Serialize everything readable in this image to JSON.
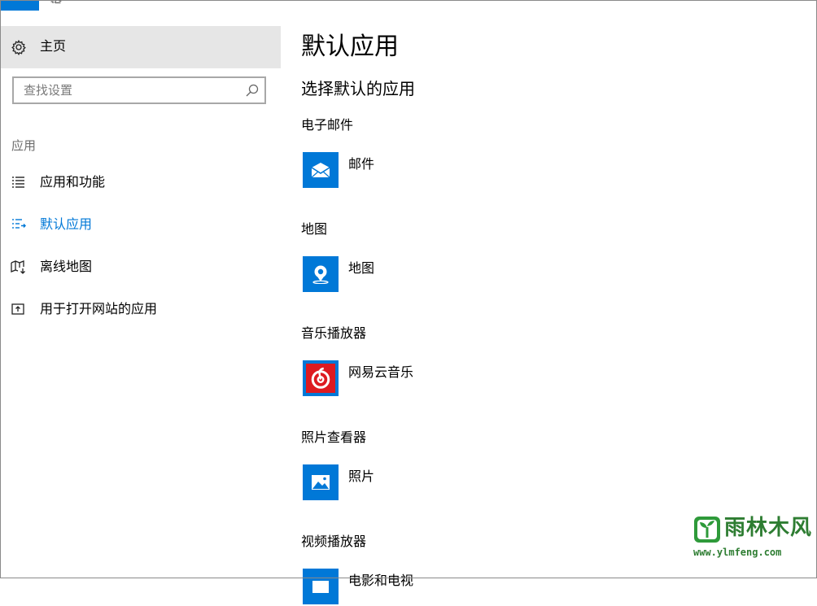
{
  "window": {
    "title_fragment": "设置",
    "accent_color": "#0078d7"
  },
  "sidebar": {
    "home": {
      "label": "主页",
      "icon": "gear-icon"
    },
    "search": {
      "placeholder": "查找设置",
      "value": "",
      "icon": "search-icon"
    },
    "section_label": "应用",
    "items": [
      {
        "label": "应用和功能",
        "icon": "list-icon",
        "active": false
      },
      {
        "label": "默认应用",
        "icon": "default-apps-icon",
        "active": true
      },
      {
        "label": "离线地图",
        "icon": "offline-map-icon",
        "active": false
      },
      {
        "label": "用于打开网站的应用",
        "icon": "open-website-icon",
        "active": false
      }
    ]
  },
  "main": {
    "title": "默认应用",
    "subtitle": "选择默认的应用",
    "categories": [
      {
        "label": "电子邮件",
        "app": "邮件",
        "icon": "mail-icon",
        "tile_color": "#0078d7"
      },
      {
        "label": "地图",
        "app": "地图",
        "icon": "maps-icon",
        "tile_color": "#0078d7"
      },
      {
        "label": "音乐播放器",
        "app": "网易云音乐",
        "icon": "netease-music-icon",
        "tile_color": "#0078d7"
      },
      {
        "label": "照片查看器",
        "app": "照片",
        "icon": "photos-icon",
        "tile_color": "#0078d7"
      },
      {
        "label": "视频播放器",
        "app": "电影和电视",
        "icon": "movies-tv-icon",
        "tile_color": "#0078d7"
      }
    ]
  },
  "watermark": {
    "name": "雨林木风",
    "url": "www.ylmfeng.com",
    "color": "#2e7d32"
  }
}
